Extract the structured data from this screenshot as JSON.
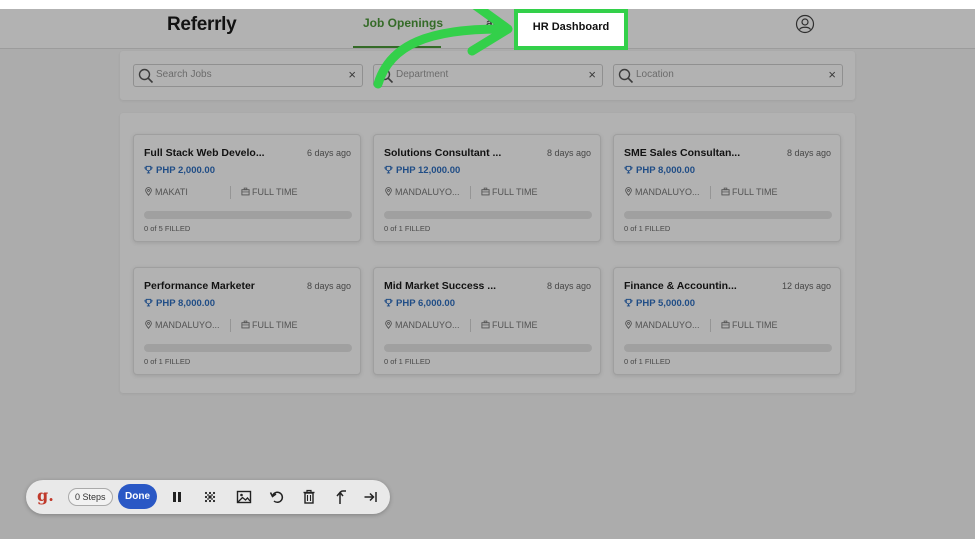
{
  "app": {
    "logo": "Referrly"
  },
  "nav": {
    "tab_jobs": "Job Openings",
    "tab_referrals": "als",
    "highlight": "HR Dashboard"
  },
  "search": {
    "jobs_placeholder": "Search Jobs",
    "department_placeholder": "Department",
    "location_placeholder": "Location",
    "clear": "×"
  },
  "jobs": [
    {
      "title": "Full Stack Web Develo...",
      "ago": "6 days ago",
      "reward": "PHP 2,000.00",
      "location": "MAKATI",
      "type": "FULL TIME",
      "progress": 0,
      "filled": "0 of 5 FILLED"
    },
    {
      "title": "Solutions Consultant ...",
      "ago": "8 days ago",
      "reward": "PHP 12,000.00",
      "location": "MANDALUYO...",
      "type": "FULL TIME",
      "progress": 0,
      "filled": "0 of 1 FILLED"
    },
    {
      "title": "SME Sales Consultan...",
      "ago": "8 days ago",
      "reward": "PHP 8,000.00",
      "location": "MANDALUYO...",
      "type": "FULL TIME",
      "progress": 0,
      "filled": "0 of 1 FILLED"
    },
    {
      "title": "Performance Marketer",
      "ago": "8 days ago",
      "reward": "PHP 8,000.00",
      "location": "MANDALUYO...",
      "type": "FULL TIME",
      "progress": 0,
      "filled": "0 of 1 FILLED"
    },
    {
      "title": "Mid Market Success ...",
      "ago": "8 days ago",
      "reward": "PHP 6,000.00",
      "location": "MANDALUYO...",
      "type": "FULL TIME",
      "progress": 0,
      "filled": "0 of 1 FILLED"
    },
    {
      "title": "Finance & Accountin...",
      "ago": "12 days ago",
      "reward": "PHP 5,000.00",
      "location": "MANDALUYO...",
      "type": "FULL TIME",
      "progress": 0,
      "filled": "0 of 1 FILLED"
    }
  ],
  "toolbar": {
    "logo": "g.",
    "steps": "0 Steps",
    "done": "Done"
  },
  "icons": {
    "search": "search-icon",
    "pin": "map-pin-icon",
    "briefcase": "briefcase-icon",
    "trophy": "trophy-icon",
    "avatar": "user-avatar-icon",
    "pause": "pause-icon",
    "blur": "blur-icon",
    "image": "image-icon",
    "undo": "undo-icon",
    "trash": "trash-icon",
    "share": "share-icon",
    "skip": "skip-end-icon"
  },
  "colors": {
    "accent": "#4c9a3a",
    "reward": "#2f6fc0",
    "highlight": "#33d04a",
    "done_button": "#2a58c5",
    "brand_logo": "#c0392b"
  }
}
